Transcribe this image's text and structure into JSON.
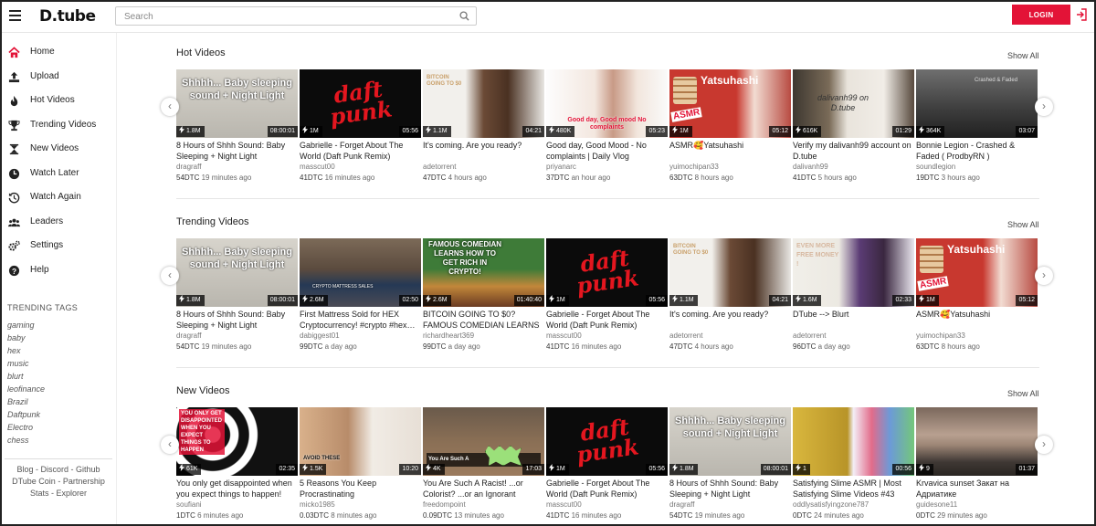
{
  "app": {
    "logo": "D.tube",
    "login_label": "LOGIN"
  },
  "search": {
    "placeholder": "Search"
  },
  "colors": {
    "accent": "#e31337",
    "text": "#222222",
    "muted": "#777777"
  },
  "sidebar": {
    "items": [
      {
        "label": "Home",
        "icon": "home-icon"
      },
      {
        "label": "Upload",
        "icon": "upload-icon"
      },
      {
        "label": "Hot Videos",
        "icon": "fire-icon"
      },
      {
        "label": "Trending Videos",
        "icon": "trophy-icon"
      },
      {
        "label": "New Videos",
        "icon": "hourglass-icon"
      },
      {
        "label": "Watch Later",
        "icon": "clock-icon"
      },
      {
        "label": "Watch Again",
        "icon": "history-icon"
      },
      {
        "label": "Leaders",
        "icon": "users-icon"
      },
      {
        "label": "Settings",
        "icon": "gears-icon"
      },
      {
        "label": "Help",
        "icon": "question-icon"
      }
    ],
    "tags_title": "TRENDING TAGS",
    "tags": [
      "gaming",
      "baby",
      "hex",
      "music",
      "blurt",
      "leofinance",
      "Brazil",
      "Daftpunk",
      "Electro",
      "chess"
    ],
    "footer": {
      "line1": [
        "Blog",
        "Discord",
        "Github"
      ],
      "line2": [
        "DTube Coin",
        "Partnership"
      ],
      "line3": [
        "Stats",
        "Explorer"
      ],
      "separator": " - "
    }
  },
  "sections": [
    {
      "title": "Hot Videos",
      "show_all": "Show All",
      "videos": [
        {
          "title": "8 Hours of Shhh Sound: Baby Sleeping + Night Light",
          "author": "dragraff",
          "value": "54DTC",
          "age": "19 minutes ago",
          "views": "1.8M",
          "duration": "08:00:01",
          "thumb": "shhh"
        },
        {
          "title": "Gabrielle - Forget About The World (Daft Punk Remix)",
          "author": "masscut00",
          "value": "41DTC",
          "age": "16 minutes ago",
          "views": "1M",
          "duration": "05:56",
          "thumb": "daft"
        },
        {
          "title": "It's coming. Are you ready?",
          "author": "adetorrent",
          "value": "47DTC",
          "age": "4 hours ago",
          "views": "1.1M",
          "duration": "04:21",
          "thumb": "coming"
        },
        {
          "title": "Good day, Good Mood - No complaints | Daily Vlog",
          "author": "priyanarc",
          "value": "37DTC",
          "age": "an hour ago",
          "views": "480K",
          "duration": "05:23",
          "thumb": "goodday"
        },
        {
          "title": "ASMR🥰Yatsuhashi",
          "author": "yuimochipan33",
          "value": "63DTC",
          "age": "8 hours ago",
          "views": "1M",
          "duration": "05:12",
          "thumb": "yatsu"
        },
        {
          "title": "Verify my dalivanh99 account on D.tube",
          "author": "dalivanh99",
          "value": "41DTC",
          "age": "5 hours ago",
          "views": "616K",
          "duration": "01:29",
          "thumb": "verify"
        },
        {
          "title": "Bonnie Legion - Crashed & Faded ( ProdbyRN )",
          "author": "soundlegion",
          "value": "19DTC",
          "age": "3 hours ago",
          "views": "364K",
          "duration": "03:07",
          "thumb": "bonnie"
        }
      ]
    },
    {
      "title": "Trending Videos",
      "show_all": "Show All",
      "videos": [
        {
          "title": "8 Hours of Shhh Sound: Baby Sleeping + Night Light",
          "author": "dragraff",
          "value": "54DTC",
          "age": "19 minutes ago",
          "views": "1.8M",
          "duration": "08:00:01",
          "thumb": "shhh"
        },
        {
          "title": "First Mattress Sold for HEX Cryptocurrency! #crypto #hex…",
          "author": "dabiggest01",
          "value": "99DTC",
          "age": "a day ago",
          "views": "2.6M",
          "duration": "02:50",
          "thumb": "mattress"
        },
        {
          "title": "BITCOIN GOING TO $0? FAMOUS COMEDIAN LEARNS HOW TO…",
          "author": "richardheart369",
          "value": "99DTC",
          "age": "a day ago",
          "views": "2.6M",
          "duration": "01:40:40",
          "thumb": "comedian"
        },
        {
          "title": "Gabrielle - Forget About The World (Daft Punk Remix)",
          "author": "masscut00",
          "value": "41DTC",
          "age": "16 minutes ago",
          "views": "1M",
          "duration": "05:56",
          "thumb": "daft"
        },
        {
          "title": "It's coming. Are you ready?",
          "author": "adetorrent",
          "value": "47DTC",
          "age": "4 hours ago",
          "views": "1.1M",
          "duration": "04:21",
          "thumb": "coming"
        },
        {
          "title": "DTube --> Blurt",
          "author": "adetorrent",
          "value": "96DTC",
          "age": "a day ago",
          "views": "1.6M",
          "duration": "02:33",
          "thumb": "blurt"
        },
        {
          "title": "ASMR🥰Yatsuhashi",
          "author": "yuimochipan33",
          "value": "63DTC",
          "age": "8 hours ago",
          "views": "1M",
          "duration": "05:12",
          "thumb": "yatsu"
        }
      ]
    },
    {
      "title": "New Videos",
      "show_all": "Show All",
      "videos": [
        {
          "title": "You only get disappointed when you expect things to happen!",
          "author": "soufiani",
          "value": "1DTC",
          "age": "6 minutes ago",
          "views": "61K",
          "duration": "02:35",
          "thumb": "disappointed"
        },
        {
          "title": "5 Reasons You Keep Procrastinating",
          "author": "micko1985",
          "value": "0.03DTC",
          "age": "8 minutes ago",
          "views": "1.5K",
          "duration": "10:20",
          "thumb": "procrast"
        },
        {
          "title": "You Are Such A Racist! ...or Colorist? ...or an Ignorant Catch…",
          "author": "freedompoint",
          "value": "0.09DTC",
          "age": "13 minutes ago",
          "views": "4K",
          "duration": "17:03",
          "thumb": "racist"
        },
        {
          "title": "Gabrielle - Forget About The World (Daft Punk Remix)",
          "author": "masscut00",
          "value": "41DTC",
          "age": "16 minutes ago",
          "views": "1M",
          "duration": "05:56",
          "thumb": "daft"
        },
        {
          "title": "8 Hours of Shhh Sound: Baby Sleeping + Night Light",
          "author": "dragraff",
          "value": "54DTC",
          "age": "19 minutes ago",
          "views": "1.8M",
          "duration": "08:00:01",
          "thumb": "shhh"
        },
        {
          "title": "Satisfying Slime ASMR | Most Satisfying Slime Videos #43",
          "author": "oddlysatisfyingzone787",
          "value": "0DTC",
          "age": "24 minutes ago",
          "views": "1",
          "duration": "00:56",
          "thumb": "slime"
        },
        {
          "title": "Krvavica sunset Закат на Адриатике",
          "author": "guidesone11",
          "value": "0DTC",
          "age": "29 minutes ago",
          "views": "9",
          "duration": "01:37",
          "thumb": "sunset"
        }
      ]
    }
  ],
  "thumb_text": {
    "shhh": "Shhhh... Baby sleeping sound + Night Light",
    "daft": "daft punk",
    "coming": "BITCOIN GOING TO $0",
    "goodday": "Good day, Good mood No complaints",
    "yatsu": "Yatsuhashi",
    "yatsu_sub": "ASMR",
    "verify": "dalivanh99 on D.tube",
    "bonnie": "Crashed & Faded",
    "mattress": "CRYPTO MATTRESS SALES",
    "comedian": "FAMOUS COMEDIAN LEARNS HOW TO GET RICH IN CRYPTO!",
    "blurt": "EVEN MORE FREE MONEY !",
    "disappointed": "YOU ONLY GET DISAPPOINTED WHEN YOU EXPECT THINGS TO HAPPEN",
    "procrast": "AVOID THESE",
    "racist": "You Are Such A"
  }
}
